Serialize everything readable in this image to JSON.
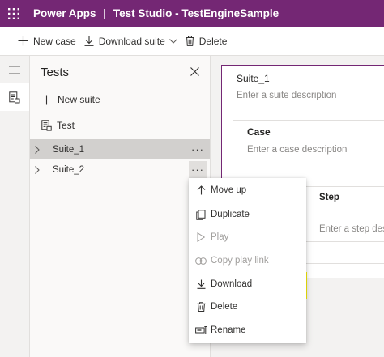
{
  "titlebar": {
    "app_name": "Power Apps",
    "separator": "|",
    "context_title": "Test Studio - TestEngineSample",
    "bg_color": "#742774"
  },
  "commandbar": {
    "new_case": "New case",
    "download_suite": "Download suite",
    "delete": "Delete"
  },
  "rail": {
    "items": [
      {
        "icon": "hamburger-menu-icon"
      },
      {
        "icon": "test-studio-icon",
        "active": true
      }
    ]
  },
  "pane": {
    "title": "Tests",
    "new_suite": "New suite",
    "test_item": "Test",
    "suites": [
      {
        "label": "Suite_1",
        "selected": true,
        "more": "···"
      },
      {
        "label": "Suite_2",
        "selected": false,
        "more": "···"
      }
    ]
  },
  "suite": {
    "title": "Suite_1",
    "description_placeholder": "Enter a suite description"
  },
  "case": {
    "title": "Case",
    "description_placeholder": "Enter a case description"
  },
  "steps": {
    "header": "Step",
    "description_placeholder": "Enter a step des"
  },
  "context_menu": {
    "items": [
      {
        "label": "Move up",
        "icon": "arrow-up-icon",
        "disabled": false
      },
      {
        "label": "Duplicate",
        "icon": "copy-icon",
        "disabled": false
      },
      {
        "label": "Play",
        "icon": "play-icon",
        "disabled": true
      },
      {
        "label": "Copy play link",
        "icon": "link-icon",
        "disabled": true
      },
      {
        "label": "Download",
        "icon": "download-icon",
        "disabled": false,
        "highlighted": true
      },
      {
        "label": "Delete",
        "icon": "delete-icon",
        "disabled": false
      },
      {
        "label": "Rename",
        "icon": "rename-icon",
        "disabled": false
      }
    ],
    "highlight_color": "#fbf20b"
  }
}
